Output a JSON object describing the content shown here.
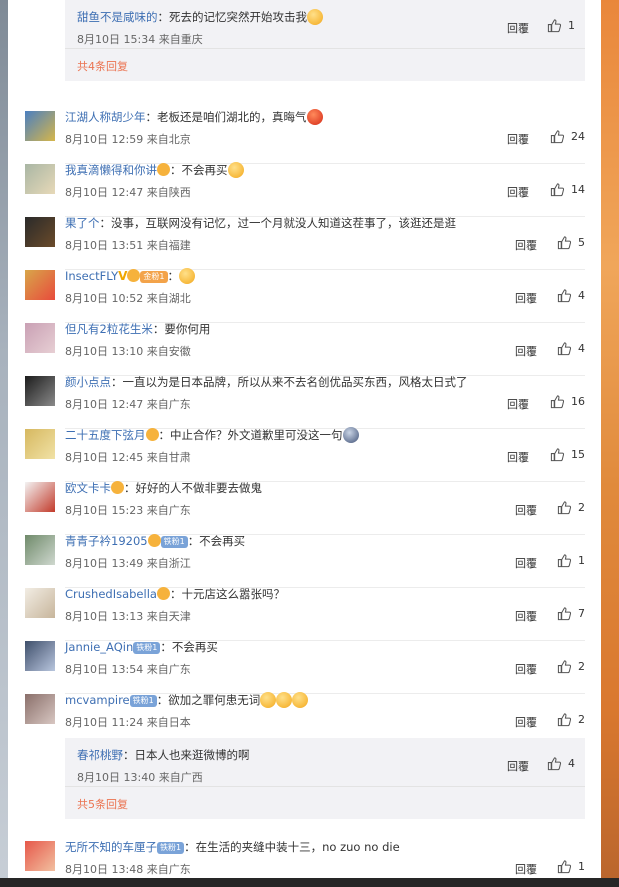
{
  "reply_label": "回覆",
  "nested_top": {
    "name": "甜鱼不是咸味的",
    "text": "：死去的记忆突然开始攻击我",
    "meta": "8月10日 15:34 来自重庆",
    "likes": "1",
    "more": "共4条回复"
  },
  "comments": [
    {
      "name": "江湖人称胡少年",
      "text": "：老板还是咱们湖北的，真晦气",
      "meta": "8月10日 12:59 来自北京",
      "likes": "24",
      "emoji": "red",
      "avatar": [
        "#4a7fc1",
        "#d6b64a"
      ]
    },
    {
      "name": "我真滴懒得和你讲",
      "text": "：不会再买",
      "meta": "8月10日 12:47 来自陕西",
      "likes": "14",
      "emoji": "yellow",
      "vip": true,
      "avatar": [
        "#a9b6a4",
        "#e7d9b8"
      ]
    },
    {
      "name": "果了个",
      "text": "：没事，互联网没有记忆，过一个月就没人知道这茬事了，该逛还是逛",
      "meta": "8月10日 13:51 来自福建",
      "likes": "5",
      "avatar": [
        "#2a2a2a",
        "#6b4b2a"
      ]
    },
    {
      "name": "InsectFLY",
      "text": "：",
      "meta": "8月10日 10:52 来自湖北",
      "likes": "4",
      "v": "V",
      "badge": "金粉1",
      "badge_color": "orange",
      "vip": true,
      "emoji": "yellow",
      "avatar": [
        "#d8a64a",
        "#e84b3c"
      ]
    },
    {
      "name": "但凡有2粒花生米",
      "text": "：要你何用",
      "meta": "8月10日 13:10 来自安徽",
      "likes": "4",
      "avatar": [
        "#c9a0b4",
        "#e7cfd4"
      ]
    },
    {
      "name": "颜小点点",
      "text": "：一直以为是日本品牌，所以从来不去名创优品买东西，风格太日式了",
      "meta": "8月10日 12:47 来自广东",
      "likes": "16",
      "avatar": [
        "#1c1c1c",
        "#8a8a8a"
      ]
    },
    {
      "name": "二十五度下弦月",
      "text": "：中止合作？外文道歉里可没这一句",
      "meta": "8月10日 12:45 来自甘肃",
      "likes": "15",
      "vip": true,
      "emoji": "blue",
      "avatar": [
        "#d6b860",
        "#f1e2a6"
      ]
    },
    {
      "name": "欧文卡卡",
      "text": "：好好的人不做非要去做鬼",
      "meta": "8月10日 15:23 来自广东",
      "likes": "2",
      "vip": true,
      "avatar": [
        "#f3f3f3",
        "#c23a2a"
      ]
    },
    {
      "name": "青青子衿19205",
      "text": "：不会再买",
      "meta": "8月10日 13:49 来自浙江",
      "likes": "1",
      "vip": true,
      "badge": "铁粉1",
      "badge_color": "blue",
      "avatar": [
        "#6f8a6a",
        "#cfd8cf"
      ]
    },
    {
      "name": "CrushedIsabella",
      "text": "：十元店这么嚣张吗？",
      "meta": "8月10日 13:13 来自天津",
      "likes": "7",
      "vip": true,
      "avatar": [
        "#f2ede4",
        "#c7b59b"
      ]
    },
    {
      "name": "Jannie_AQin",
      "text": "：不会再买",
      "meta": "8月10日 13:54 来自广东",
      "likes": "2",
      "badge": "铁粉1",
      "badge_color": "blue",
      "avatar": [
        "#3f4f6b",
        "#b8c6de"
      ]
    },
    {
      "name": "mcvampire",
      "text": "：欲加之罪何患无词",
      "meta": "8月10日 11:24 来自日本",
      "likes": "2",
      "badge": "铁粉1",
      "badge_color": "blue",
      "emoji3": true,
      "avatar": [
        "#8a6f6a",
        "#d8c7c2"
      ]
    }
  ],
  "nested_bottom": {
    "name": "春祁桃野",
    "text": "：日本人也来逛微博的啊",
    "meta": "8月10日 13:40 来自广西",
    "likes": "4",
    "more": "共5条回复"
  },
  "last_comment": {
    "name": "无所不知的车厘子",
    "text": "：在生活的夹缝中装十三，no zuo no die",
    "meta": "8月10日 13:48 来自广东",
    "likes": "1",
    "badge": "铁粉1",
    "badge_color": "blue",
    "avatar": [
      "#e6584a",
      "#f2c0a0"
    ]
  }
}
